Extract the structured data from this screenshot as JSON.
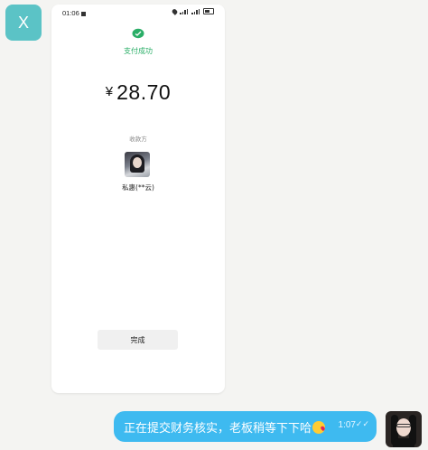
{
  "contact": {
    "avatar_letter": "X"
  },
  "screenshot": {
    "status_bar": {
      "time": "01:06"
    },
    "pay_title": "支付成功",
    "amount": {
      "currency": "¥",
      "value": "28.70"
    },
    "payee_label": "收款方",
    "payee_name": "私惠(**云)",
    "done_label": "完成"
  },
  "message": {
    "text": "正在提交财务核实，老板稍等下下哈",
    "emoji": "kissing-face-emoji",
    "time": "1:07",
    "read_icon": "✓✓"
  },
  "colors": {
    "accent": "#3ebaf0",
    "success": "#2aae67",
    "contact_avatar": "#5bc3c6"
  }
}
